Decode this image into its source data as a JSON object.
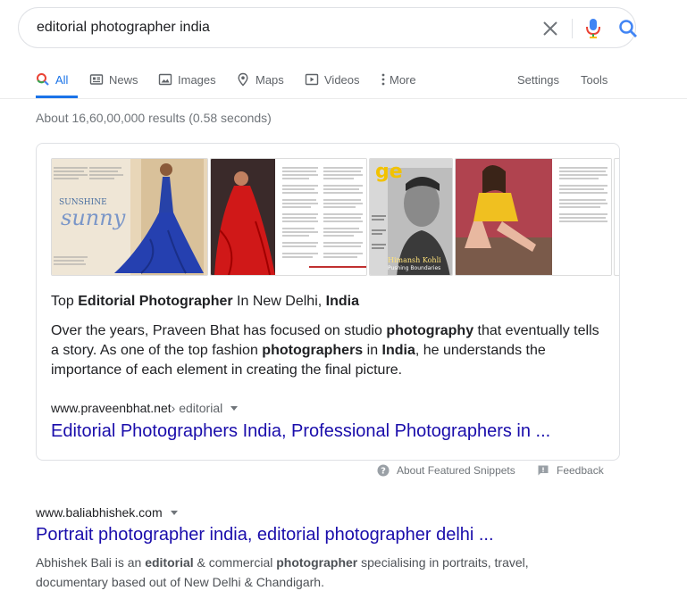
{
  "search": {
    "query": "editorial photographer india"
  },
  "tabs": {
    "all": "All",
    "news": "News",
    "images": "Images",
    "maps": "Maps",
    "videos": "Videos",
    "more": "More",
    "settings": "Settings",
    "tools": "Tools"
  },
  "stats": "About 16,60,00,000 results (0.58 seconds)",
  "snippet": {
    "images": [
      {
        "text_top": "SUNSHINE",
        "text_main": "sunny"
      },
      {
        "text_top": ""
      },
      {
        "brand": "ge",
        "caption_name": "Himansh Kohli",
        "caption_sub": "Pushing Boundaries"
      },
      {
        "text_top": ""
      }
    ],
    "title_pre": "Top ",
    "title_b1": "Editorial Photographer",
    "title_mid": " In New Delhi, ",
    "title_b2": "India",
    "body_1": "Over the years, Praveen Bhat has focused on studio ",
    "body_b1": "photography",
    "body_2": " that eventually tells a story. As one of the top fashion ",
    "body_b2": "photographers",
    "body_3": " in ",
    "body_b3": "India",
    "body_4": ", he understands the importance of each element in creating the final picture.",
    "url_domain": "www.praveenbhat.net",
    "url_path": " › editorial",
    "link": "Editorial Photographers India, Professional Photographers in ..."
  },
  "footer": {
    "about": "About Featured Snippets",
    "feedback": "Feedback"
  },
  "result2": {
    "url": "www.baliabhishek.com",
    "title": "Portrait photographer india, editorial photographer delhi ...",
    "desc_1": "Abhishek Bali is an ",
    "desc_b1": "editorial",
    "desc_2": " & commercial ",
    "desc_b2": "photographer",
    "desc_3": " specialising in portraits, travel, documentary based out of New Delhi & Chandigarh."
  },
  "colors": {
    "accent": "#1a73e8",
    "link": "#1a0dab",
    "muted": "#70757a"
  }
}
